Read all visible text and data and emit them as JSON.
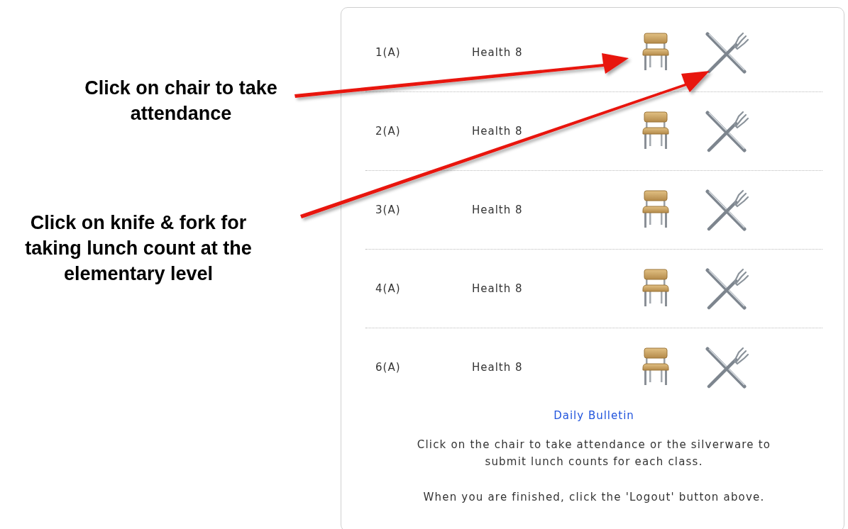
{
  "annotations": [
    {
      "text": "Click on chair to take attendance"
    },
    {
      "text": "Click on knife & fork for taking lunch count at the elementary level"
    }
  ],
  "classes": [
    {
      "period": "1(A)",
      "course": "Health 8"
    },
    {
      "period": "2(A)",
      "course": "Health 8"
    },
    {
      "period": "3(A)",
      "course": "Health 8"
    },
    {
      "period": "4(A)",
      "course": "Health 8"
    },
    {
      "period": "6(A)",
      "course": "Health 8"
    }
  ],
  "bulletin_link": "Daily Bulletin",
  "instructions": [
    "Click on the chair to take attendance or the silverware to submit lunch counts for each class.",
    "When you are finished, click the 'Logout' button above."
  ]
}
